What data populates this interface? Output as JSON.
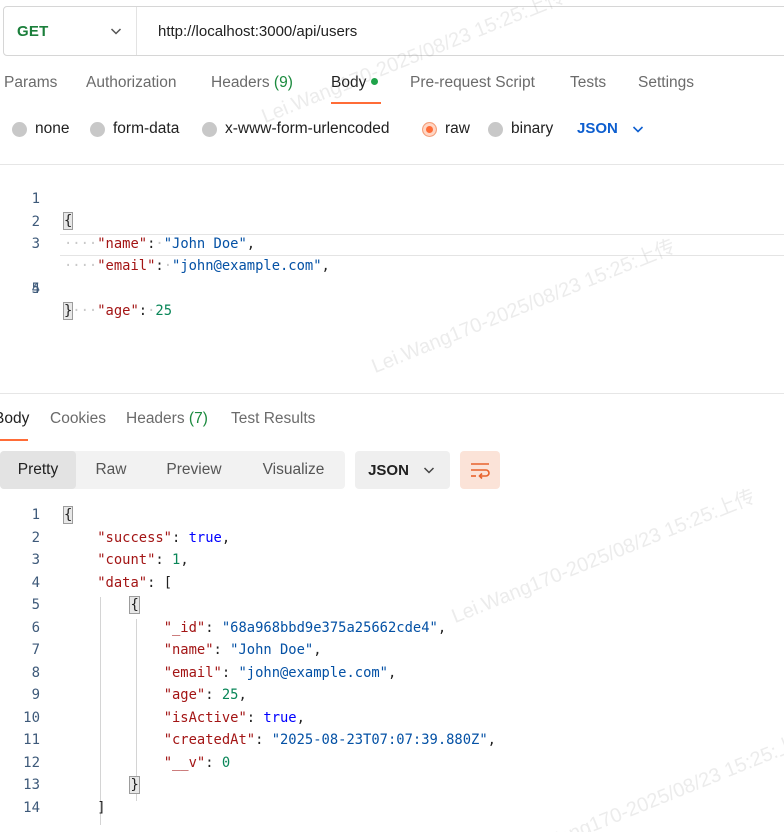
{
  "request": {
    "method": "GET",
    "url": "http://localhost:3000/api/users"
  },
  "req_tabs": {
    "params": "Params",
    "authorization": "Authorization",
    "headers": "Headers",
    "headers_count": "(9)",
    "body": "Body",
    "prerequest": "Pre-request Script",
    "tests": "Tests",
    "settings": "Settings"
  },
  "body_types": {
    "none": "none",
    "form_data": "form-data",
    "urlencoded": "x-www-form-urlencoded",
    "raw": "raw",
    "binary": "binary",
    "language": "JSON"
  },
  "request_body": {
    "line_numbers": [
      "1",
      "2",
      "3",
      "4",
      "5"
    ],
    "open": "{",
    "close": "}",
    "name_key": "\"name\"",
    "name_val": "\"John Doe\"",
    "email_key": "\"email\"",
    "email_val": "\"john@example.com\"",
    "age_key": "\"age\"",
    "age_val": "25"
  },
  "resp_tabs": {
    "body": "Body",
    "cookies": "Cookies",
    "headers": "Headers",
    "headers_count": "(7)",
    "test_results": "Test Results"
  },
  "format": {
    "pretty": "Pretty",
    "raw": "Raw",
    "preview": "Preview",
    "visualize": "Visualize",
    "language": "JSON"
  },
  "response_body": {
    "line_numbers": [
      "1",
      "2",
      "3",
      "4",
      "5",
      "6",
      "7",
      "8",
      "9",
      "10",
      "11",
      "12",
      "13",
      "14"
    ],
    "open": "{",
    "success_key": "\"success\"",
    "success_val": "true",
    "count_key": "\"count\"",
    "count_val": "1",
    "data_key": "\"data\"",
    "arr_open": "[",
    "obj_open": "{",
    "id_key": "\"_id\"",
    "id_val": "\"68a968bbd9e375a25662cde4\"",
    "name_key": "\"name\"",
    "name_val": "\"John Doe\"",
    "email_key": "\"email\"",
    "email_val": "\"john@example.com\"",
    "age_key": "\"age\"",
    "age_val": "25",
    "active_key": "\"isActive\"",
    "active_val": "true",
    "created_key": "\"createdAt\"",
    "created_val": "\"2025-08-23T07:07:39.880Z\"",
    "v_key": "\"__v\"",
    "v_val": "0",
    "obj_close": "}",
    "arr_close": "]"
  },
  "watermark": "Lei.Wang170-2025/08/23  15:25:上传",
  "colors": {
    "accent": "#ff6c37",
    "method_get": "#1b7f3b",
    "json_key": "#a31515",
    "json_string": "#0451a5",
    "json_number": "#098658",
    "json_bool": "#0000ff"
  }
}
